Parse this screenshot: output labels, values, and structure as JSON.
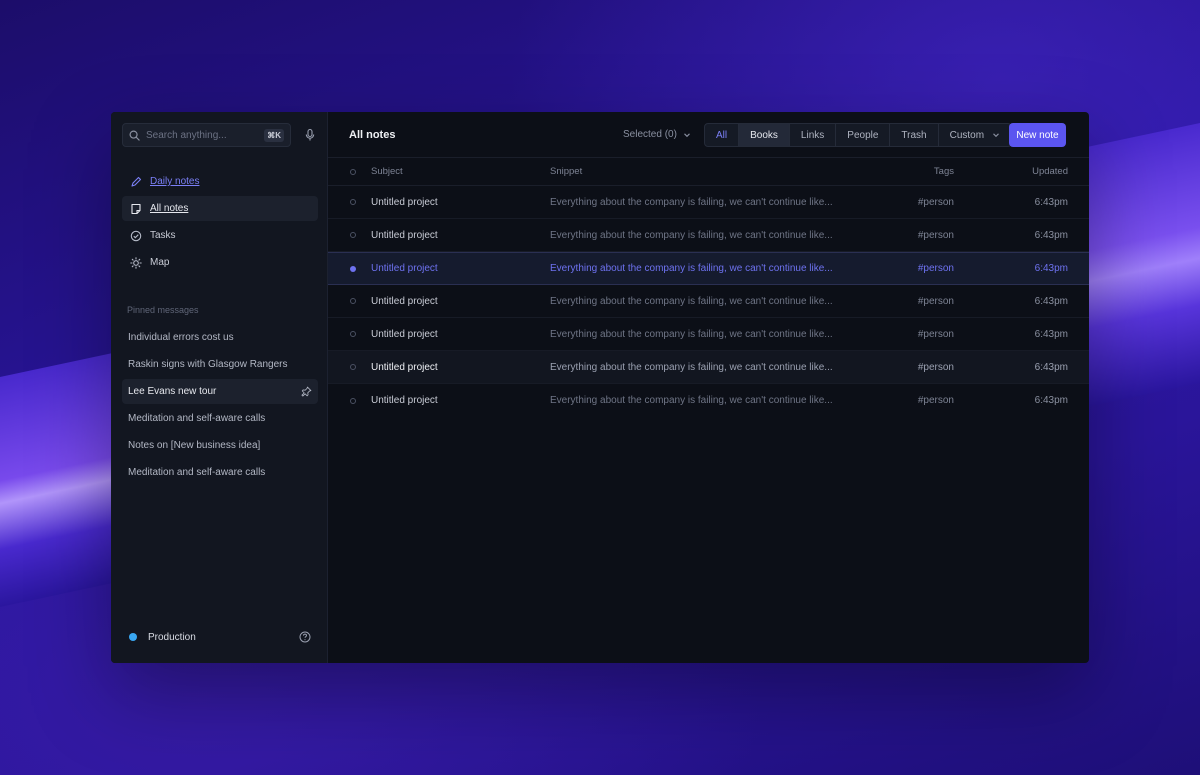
{
  "colors": {
    "accent": "#5b55f0",
    "accent_text": "#7b80f7",
    "status_production": "#39a7f2",
    "window_bg": "#0c0f17",
    "sidebar_bg": "#121620"
  },
  "sidebar": {
    "search": {
      "placeholder": "Search anything...",
      "shortcut": "⌘K"
    },
    "nav": [
      {
        "label": "Daily notes",
        "icon": "pencil-icon",
        "state": "active"
      },
      {
        "label": "All notes",
        "icon": "note-icon",
        "state": "selected"
      },
      {
        "label": "Tasks",
        "icon": "check-circle-icon",
        "state": "default"
      },
      {
        "label": "Map",
        "icon": "sun-icon",
        "state": "default"
      }
    ],
    "pinned_title": "Pinned messages",
    "pinned": [
      {
        "label": "Individual errors cost us"
      },
      {
        "label": "Raskin signs with Glasgow Rangers"
      },
      {
        "label": "Lee Evans new tour",
        "selected": true
      },
      {
        "label": "Meditation and self-aware calls"
      },
      {
        "label": "Notes on [New business idea]"
      },
      {
        "label": "Meditation and self-aware calls"
      }
    ],
    "footer": {
      "workspace": "Production"
    }
  },
  "header": {
    "title": "All notes",
    "selected_label": "Selected (0)",
    "filters": [
      "All",
      "Books",
      "Links",
      "People",
      "Trash",
      "Custom"
    ],
    "active_filter": "All",
    "new_button": "New note"
  },
  "table": {
    "columns": {
      "subject": "Subject",
      "snippet": "Snippet",
      "tags": "Tags",
      "updated": "Updated"
    },
    "rows": [
      {
        "subject": "Untitled project",
        "snippet": "Everything about the company is failing, we can't continue like...",
        "tags": "#person",
        "updated": "6:43pm"
      },
      {
        "subject": "Untitled project",
        "snippet": "Everything about the company is failing, we can't continue like...",
        "tags": "#person",
        "updated": "6:43pm"
      },
      {
        "subject": "Untitled project",
        "snippet": "Everything about the company is failing, we can't continue like...",
        "tags": "#person",
        "updated": "6:43pm"
      },
      {
        "subject": "Untitled project",
        "snippet": "Everything about the company is failing, we can't continue like...",
        "tags": "#person",
        "updated": "6:43pm"
      },
      {
        "subject": "Untitled project",
        "snippet": "Everything about the company is failing, we can't continue like...",
        "tags": "#person",
        "updated": "6:43pm"
      },
      {
        "subject": "Untitled project",
        "snippet": "Everything about the company is failing, we can't continue like...",
        "tags": "#person",
        "updated": "6:43pm"
      },
      {
        "subject": "Untitled project",
        "snippet": "Everything about the company is failing, we can't continue like...",
        "tags": "#person",
        "updated": "6:43pm"
      }
    ],
    "highlighted_row": 2,
    "hovered_row": 5
  }
}
